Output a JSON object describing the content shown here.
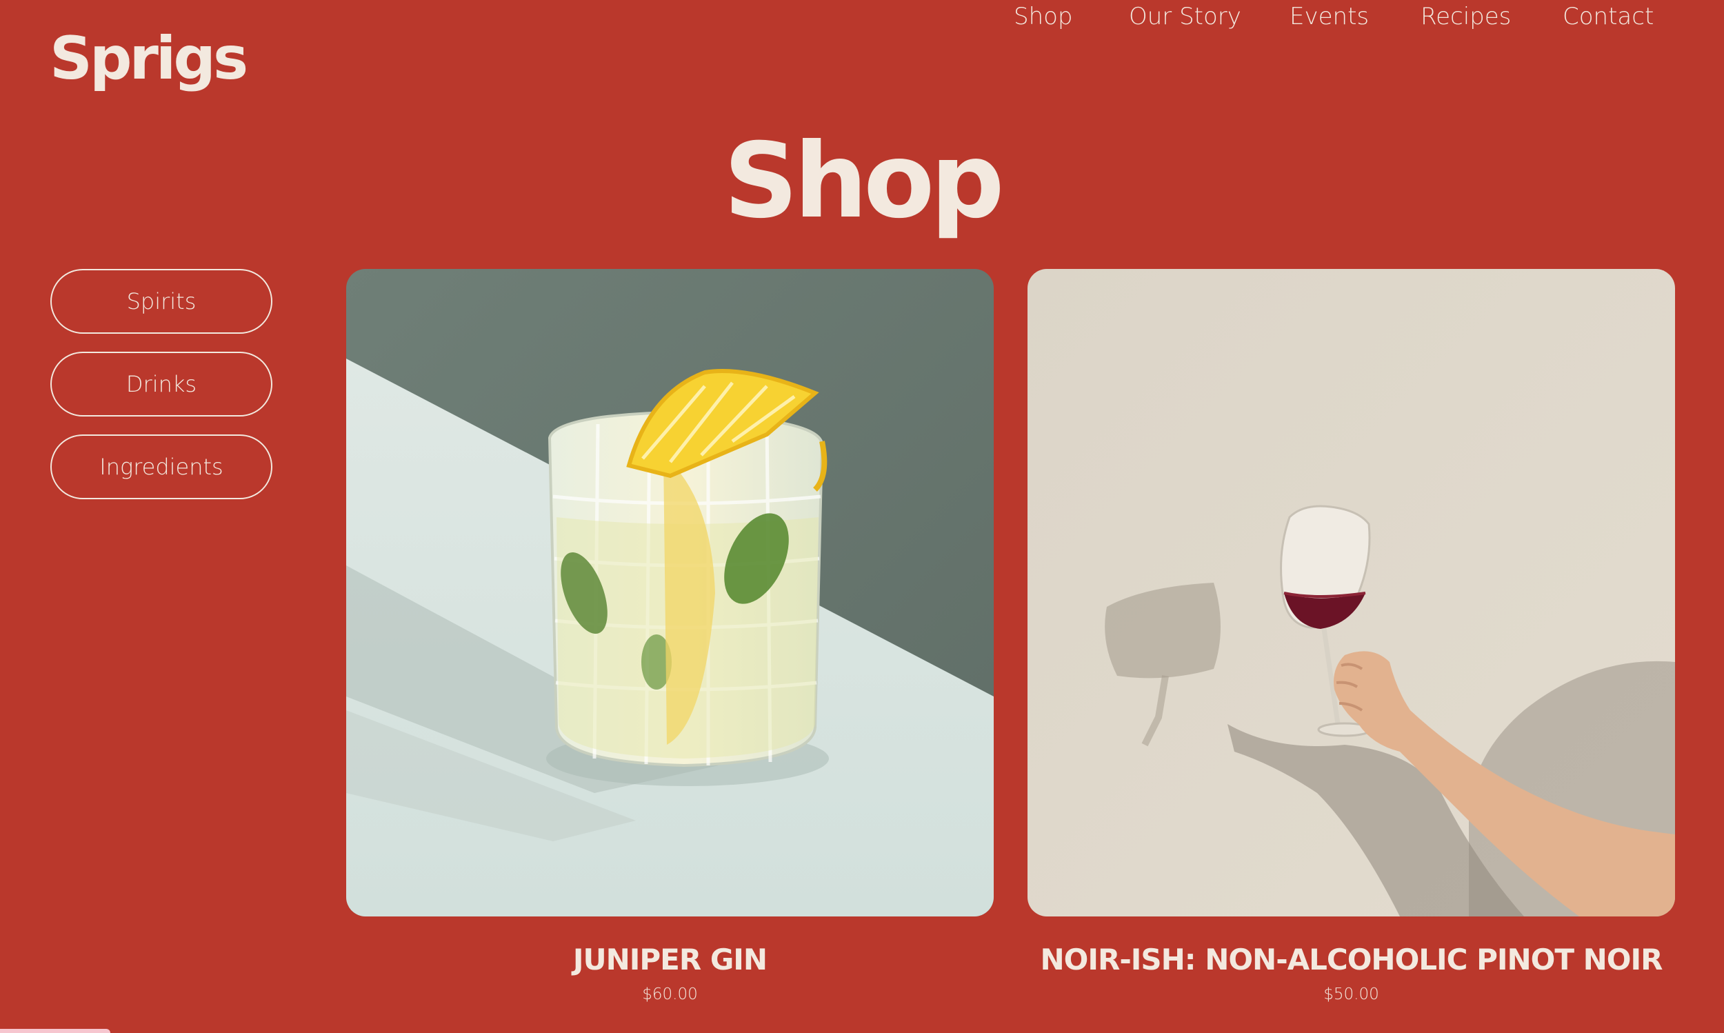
{
  "brand": {
    "logo": "Sprigs"
  },
  "nav": {
    "items": [
      {
        "label": "Shop"
      },
      {
        "label": "Our Story"
      },
      {
        "label": "Events"
      },
      {
        "label": "Recipes"
      },
      {
        "label": "Contact"
      }
    ]
  },
  "page": {
    "title": "Shop"
  },
  "filters": {
    "items": [
      {
        "label": "Spirits"
      },
      {
        "label": "Drinks"
      },
      {
        "label": "Ingredients"
      }
    ]
  },
  "products": [
    {
      "name": "JUNIPER GIN",
      "price": "$60.00",
      "image_subject": "glass of gin with lemon slice and mint"
    },
    {
      "name": "NOIR-ISH: NON-ALCOHOLIC PINOT NOIR",
      "price": "$50.00",
      "image_subject": "hand holding a glass of red wine against a wall"
    }
  ],
  "colors": {
    "background": "#ba382c",
    "text": "#f3e9df",
    "corner_tab": "#f6c6cf"
  }
}
